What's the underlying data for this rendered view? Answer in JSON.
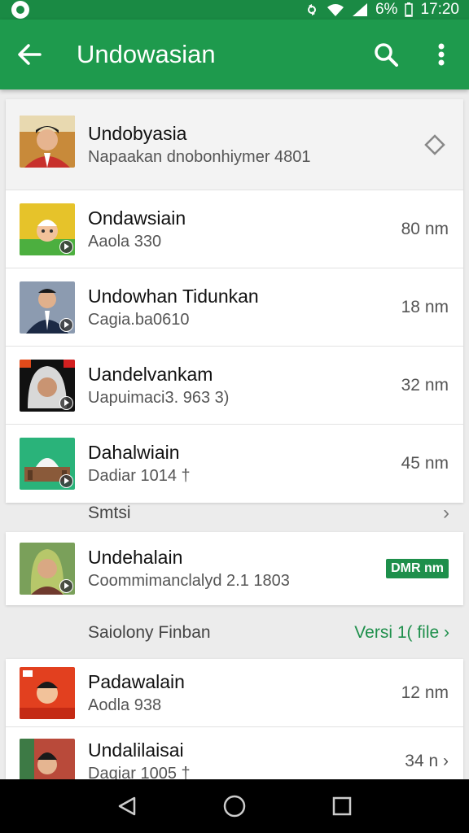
{
  "status_bar": {
    "battery": "6%",
    "time": "17:20"
  },
  "toolbar": {
    "title": "Undowasian"
  },
  "top_card": {
    "header": {
      "title": "Undobyasia",
      "subtitle": "Napaakan dnobonhiymer 4801"
    },
    "items": [
      {
        "title": "Ondawsiain",
        "subtitle": "Aaola 330",
        "meta": "80 nm"
      },
      {
        "title": "Undowhan Tidunkan",
        "subtitle": "Cagia.ba0610",
        "meta": "18 nm"
      },
      {
        "title": "Uandelvankam",
        "subtitle": "Uapuimaci3. 963 3)",
        "meta": "32 nm"
      },
      {
        "title": "Dahalwiain",
        "subtitle": "Dadiar 1014 †",
        "meta": "45 nm"
      }
    ]
  },
  "section1": {
    "title": "Smtsi"
  },
  "mid_card": {
    "title": "Undehalain",
    "subtitle": "Coommimanclalyd 2.1 1803",
    "badge": "DMR nm"
  },
  "section2": {
    "title": "Saiolony Finban",
    "link": "Versi 1( file ›"
  },
  "bottom_card": {
    "items": [
      {
        "title": "Padawalain",
        "subtitle": "Aodla 938",
        "meta": "12 nm"
      },
      {
        "title": "Undalilaisai",
        "subtitle": "Daqiar 1005 †",
        "meta": "34 n ›"
      }
    ]
  }
}
